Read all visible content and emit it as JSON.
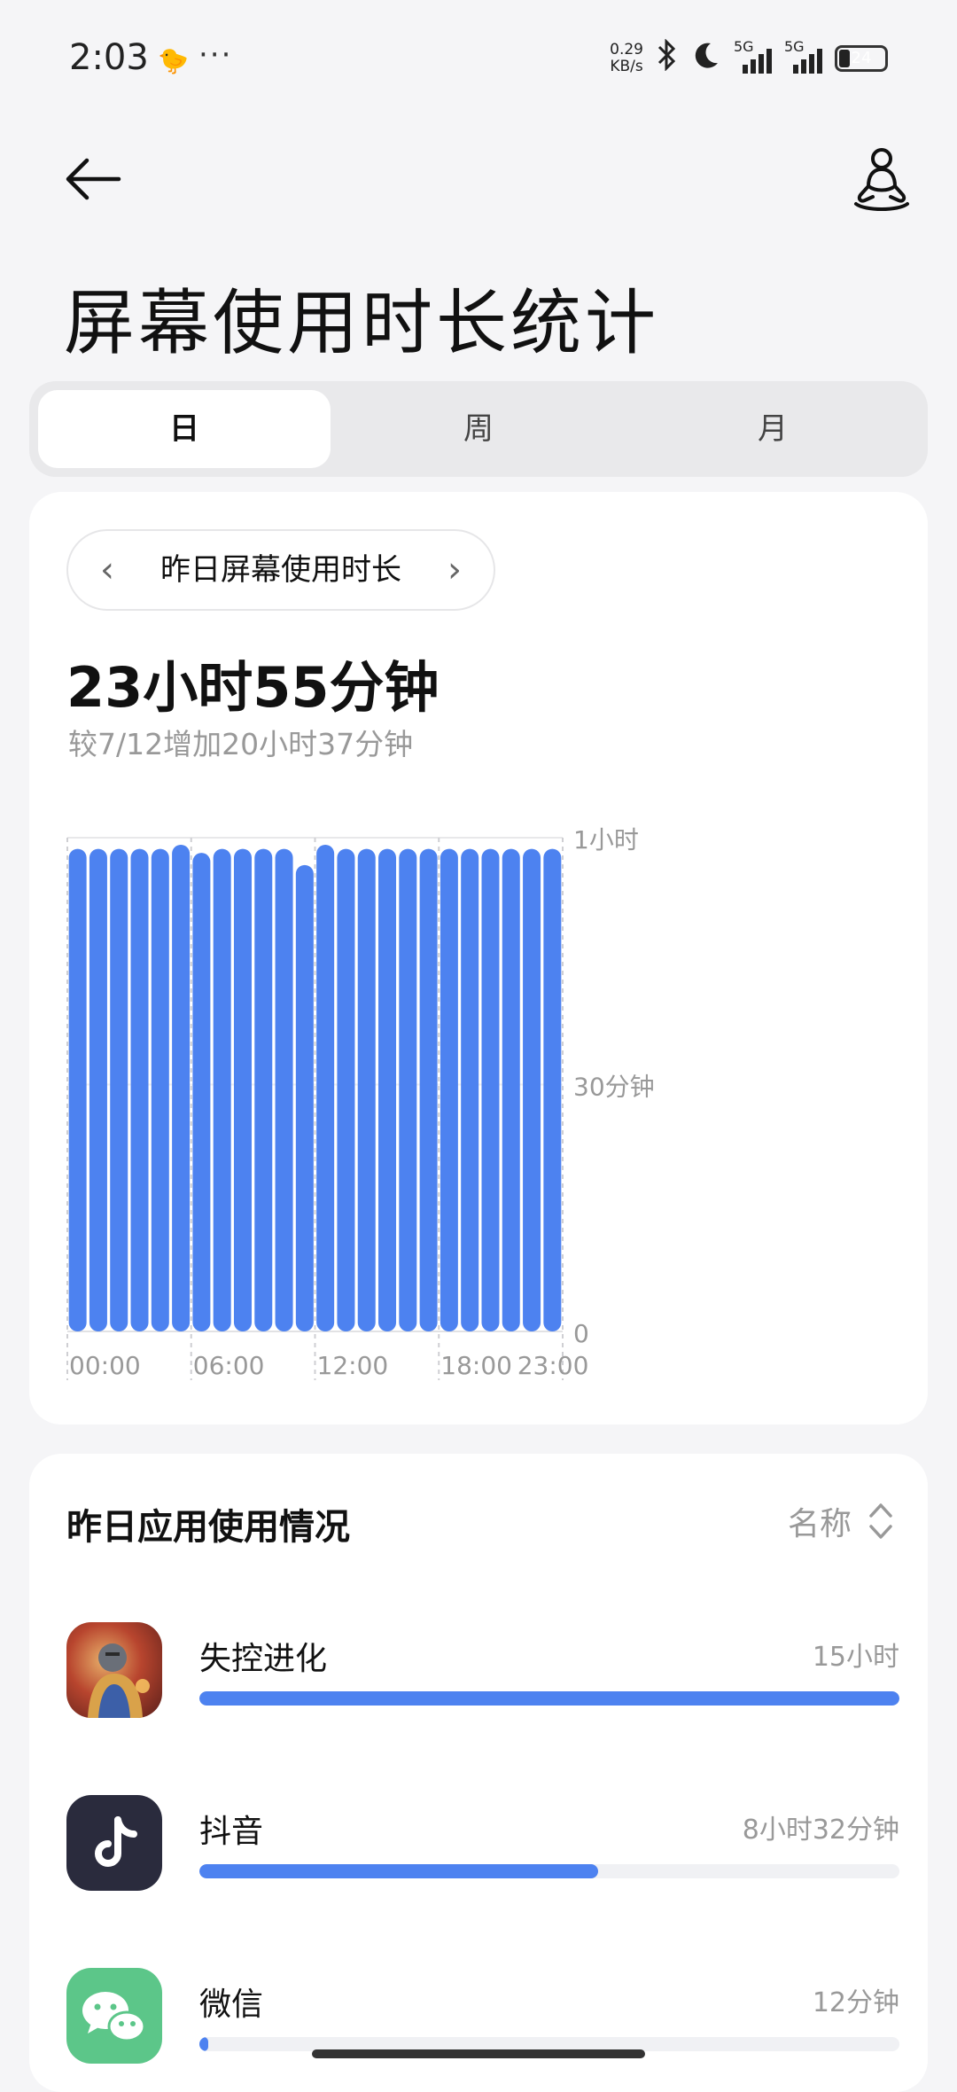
{
  "status_bar": {
    "time": "2:03",
    "more": "···",
    "net_speed_value": "0.29",
    "net_speed_unit": "KB/s",
    "signal1_label": "5G",
    "signal2_label": "5G",
    "battery": "24"
  },
  "header": {
    "title": "屏幕使用时长统计"
  },
  "tabs": [
    {
      "label": "日",
      "active": true
    },
    {
      "label": "周",
      "active": false
    },
    {
      "label": "月",
      "active": false
    }
  ],
  "summary": {
    "period_label": "昨日屏幕使用时长",
    "total": "23小时55分钟",
    "comparison": "较7/12增加20小时37分钟"
  },
  "chart_data": {
    "type": "bar",
    "title": "",
    "x_tick_labels": [
      "00:00",
      "06:00",
      "12:00",
      "18:00",
      "23:00"
    ],
    "y_tick_labels": [
      "1小时",
      "30分钟",
      "0"
    ],
    "ylim": [
      0,
      60
    ],
    "units": "minutes",
    "categories": [
      "0",
      "1",
      "2",
      "3",
      "4",
      "5",
      "6",
      "7",
      "8",
      "9",
      "10",
      "11",
      "12",
      "13",
      "14",
      "15",
      "16",
      "17",
      "18",
      "19",
      "20",
      "21",
      "22",
      "23"
    ],
    "values": [
      59.5,
      59.5,
      59.5,
      59.5,
      59.5,
      60,
      59,
      59.5,
      59.5,
      59.5,
      59.5,
      57.5,
      60,
      59.5,
      59.5,
      59.5,
      59.5,
      59.5,
      59.5,
      59.5,
      59.5,
      59.5,
      59.5,
      59.5
    ],
    "bar_color": "#4d82f0",
    "grid": true
  },
  "app_usage": {
    "title": "昨日应用使用情况",
    "sort_label": "名称",
    "apps": [
      {
        "name": "失控进化",
        "time": "15小时",
        "fraction": 1.0,
        "icon": "game-icon"
      },
      {
        "name": "抖音",
        "time": "8小时32分钟",
        "fraction": 0.569,
        "icon": "douyin-icon"
      },
      {
        "name": "微信",
        "time": "12分钟",
        "fraction": 0.013,
        "icon": "wechat-icon"
      }
    ]
  },
  "colors": {
    "accent": "#4d82f0",
    "background": "#f5f5f7",
    "wechat_green": "#5cc689",
    "douyin_dark": "#2a2b3d"
  }
}
